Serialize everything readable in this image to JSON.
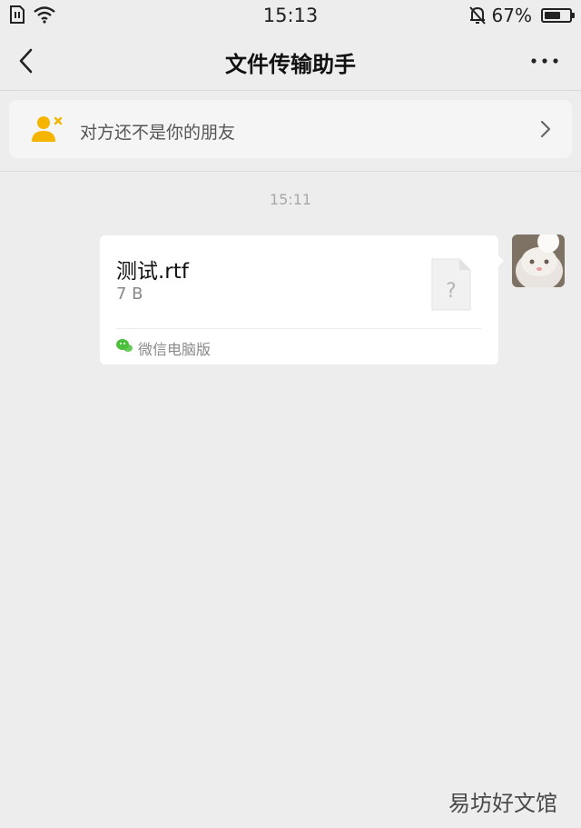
{
  "status_bar": {
    "time": "15:13",
    "battery": "67%",
    "battery_level": 0.67
  },
  "nav": {
    "title": "文件传输助手"
  },
  "banner": {
    "text": "对方还不是你的朋友"
  },
  "chat": {
    "timestamp": "15:11",
    "file": {
      "name": "测试.rtf",
      "size": "7 B",
      "icon_glyph": "?"
    },
    "source": "微信电脑版"
  },
  "watermark": "易坊好文馆",
  "colors": {
    "background": "#ededed",
    "bubble": "#ffffff",
    "banner_icon": "#f4b400",
    "wechat_green": "#4cbf3c"
  },
  "icons": {
    "back": "chevron-left-icon",
    "more": "more-dots-icon",
    "add_friend": "person-x-icon",
    "chevron": "chevron-right-icon",
    "file": "unknown-file-icon",
    "source": "wechat-icon",
    "alarm_off": "bell-off-icon",
    "wifi": "wifi-icon",
    "sim": "sim-icon"
  }
}
